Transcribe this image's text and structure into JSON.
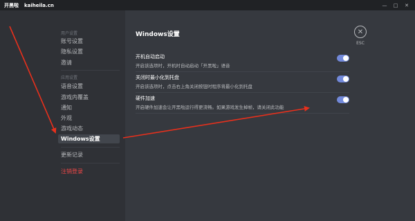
{
  "titlebar": {
    "app_name": "开黑啦",
    "url": "kaiheila.cn"
  },
  "sidebar": {
    "user_section_header": "用户设置",
    "user_items": [
      "账号设置",
      "隐私设置",
      "邀请"
    ],
    "app_section_header": "应用设置",
    "app_items": [
      "语音设置",
      "游戏内覆盖",
      "通知",
      "外观",
      "游戏动态",
      "Windows设置"
    ],
    "changelog": "更新记录",
    "logout": "注销登录"
  },
  "main": {
    "title": "Windows设置",
    "esc_label": "ESC",
    "settings": [
      {
        "title": "开机自动启动",
        "desc": "开启该选项时，开机时自动启动「开黑啦」语音",
        "enabled": true
      },
      {
        "title": "关闭时最小化到托盘",
        "desc": "开启该选项时，点击右上角关闭按钮时程序将最小化到托盘",
        "enabled": true
      },
      {
        "title": "硬件加速",
        "desc": "开启硬件加速会让开黑啦运行得更流畅。如果游戏发生掉帧，请关闭此功能",
        "enabled": true
      }
    ]
  },
  "colors": {
    "accent": "#7289da",
    "danger": "#f04747",
    "annotation_arrow": "#e8301c"
  },
  "icons": {
    "close": "close-icon",
    "minimize": "minimize-icon",
    "maximize": "maximize-icon"
  }
}
